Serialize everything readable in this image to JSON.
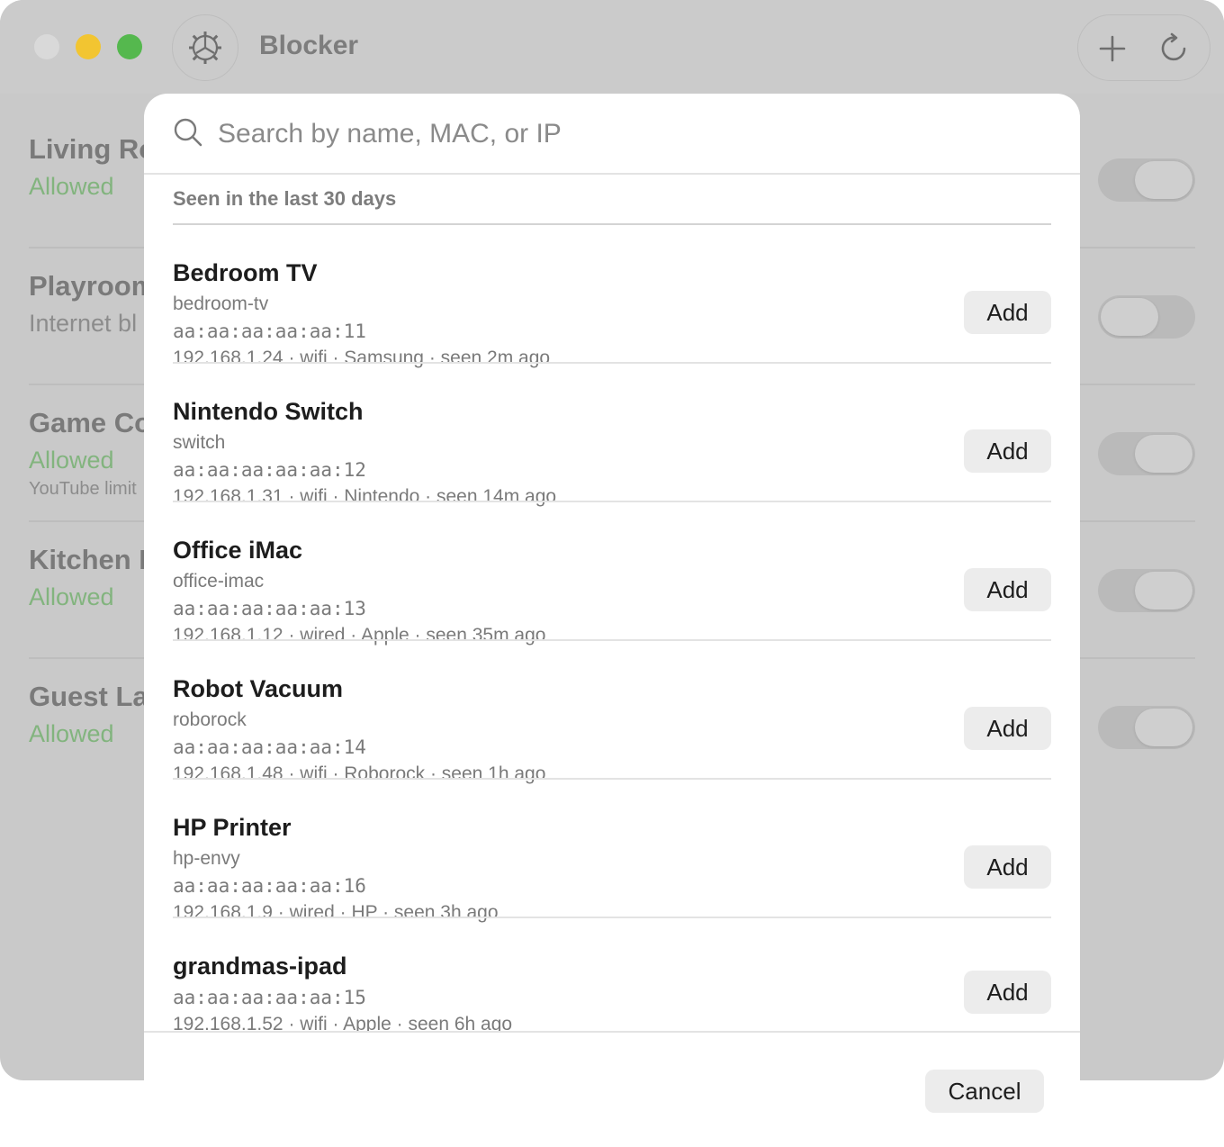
{
  "window": {
    "title": "Blocker",
    "traffic_lights": {
      "close": "#d9d9d9",
      "minimize": "#f2c531",
      "maximize": "#55b84e"
    }
  },
  "toolbar": {
    "settings_icon": "gear-icon",
    "add_icon": "plus-icon",
    "refresh_icon": "refresh-icon"
  },
  "background_devices": [
    {
      "name": "Living Ro",
      "status": "Allowed",
      "note": "",
      "toggle_on": true
    },
    {
      "name": "Playroom",
      "status": "Internet bl",
      "note": "",
      "toggle_on": false
    },
    {
      "name": "Game Co",
      "status": "Allowed",
      "note": "YouTube limit",
      "toggle_on": true
    },
    {
      "name": "Kitchen D",
      "status": "Allowed",
      "note": "",
      "toggle_on": true
    },
    {
      "name": "Guest La",
      "status": "Allowed",
      "note": "",
      "toggle_on": true
    }
  ],
  "sheet": {
    "search": {
      "placeholder": "Search by name, MAC, or IP",
      "value": ""
    },
    "section_header": "Seen in the last 30 days",
    "devices": [
      {
        "name": "Bedroom TV",
        "hostname": "bedroom-tv",
        "mac": "aa:aa:aa:aa:aa:11",
        "info": "192.168.1.24 · wifi · Samsung · seen 2m ago",
        "action": "Add"
      },
      {
        "name": "Nintendo Switch",
        "hostname": "switch",
        "mac": "aa:aa:aa:aa:aa:12",
        "info": "192.168.1.31 · wifi · Nintendo · seen 14m ago",
        "action": "Add"
      },
      {
        "name": "Office iMac",
        "hostname": "office-imac",
        "mac": "aa:aa:aa:aa:aa:13",
        "info": "192.168.1.12 · wired · Apple · seen 35m ago",
        "action": "Add"
      },
      {
        "name": "Robot Vacuum",
        "hostname": "roborock",
        "mac": "aa:aa:aa:aa:aa:14",
        "info": "192.168.1.48 · wifi · Roborock · seen 1h ago",
        "action": "Add"
      },
      {
        "name": "HP Printer",
        "hostname": "hp-envy",
        "mac": "aa:aa:aa:aa:aa:16",
        "info": "192.168.1.9 · wired · HP · seen 3h ago",
        "action": "Add"
      },
      {
        "name": "grandmas-ipad",
        "hostname": "",
        "mac": "aa:aa:aa:aa:aa:15",
        "info": "192.168.1.52 · wifi · Apple · seen 6h ago",
        "action": "Add"
      }
    ],
    "cancel_label": "Cancel"
  }
}
